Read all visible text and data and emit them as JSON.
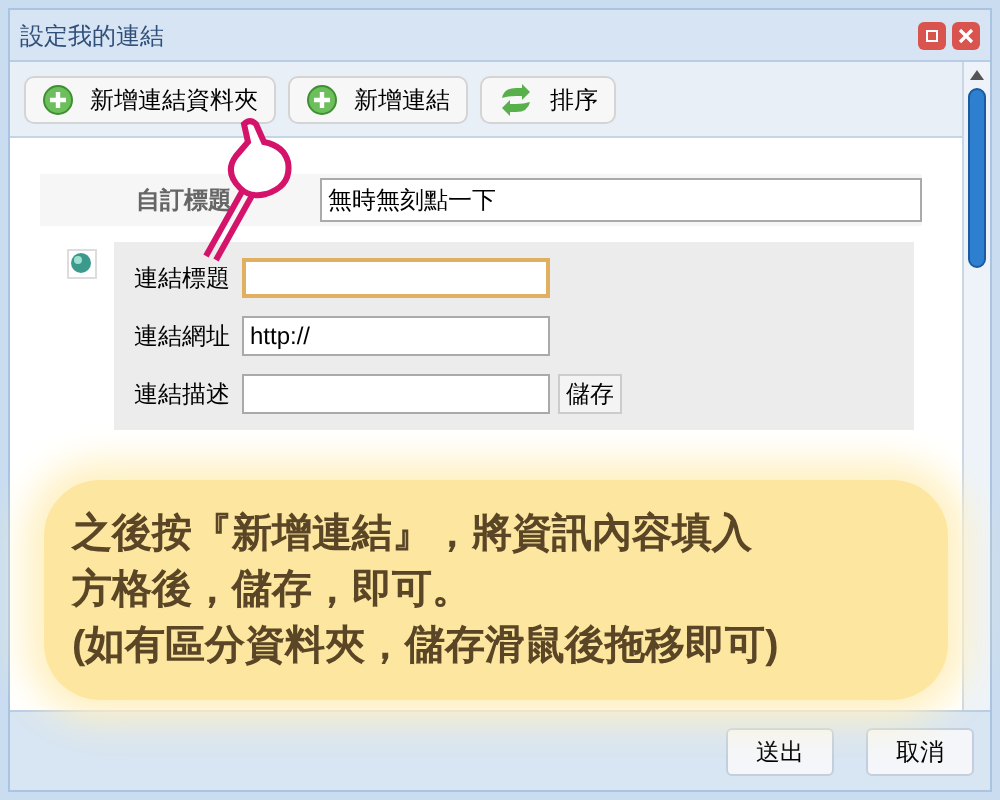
{
  "window": {
    "title": "設定我的連結"
  },
  "toolbar": [
    {
      "label": "新增連結資料夾",
      "kind": "add"
    },
    {
      "label": "新增連結",
      "kind": "add"
    },
    {
      "label": "排序",
      "kind": "sort"
    }
  ],
  "custom_title": {
    "label": "自訂標題",
    "value": "無時無刻點一下"
  },
  "link_form": {
    "fields": [
      {
        "label": "連結標題",
        "focused": true
      },
      {
        "label": "連結網址",
        "value": "http://",
        "focused": false
      },
      {
        "label": "連結描述",
        "focused": false
      }
    ],
    "save_button": "儲存"
  },
  "annotation": [
    "之後按『新增連結』，將資訊內容填入",
    "方格後，儲存，即可。",
    "(如有區分資料夾，儲存滑鼠後拖移即可)"
  ],
  "footer_buttons": [
    "送出",
    "取消"
  ]
}
